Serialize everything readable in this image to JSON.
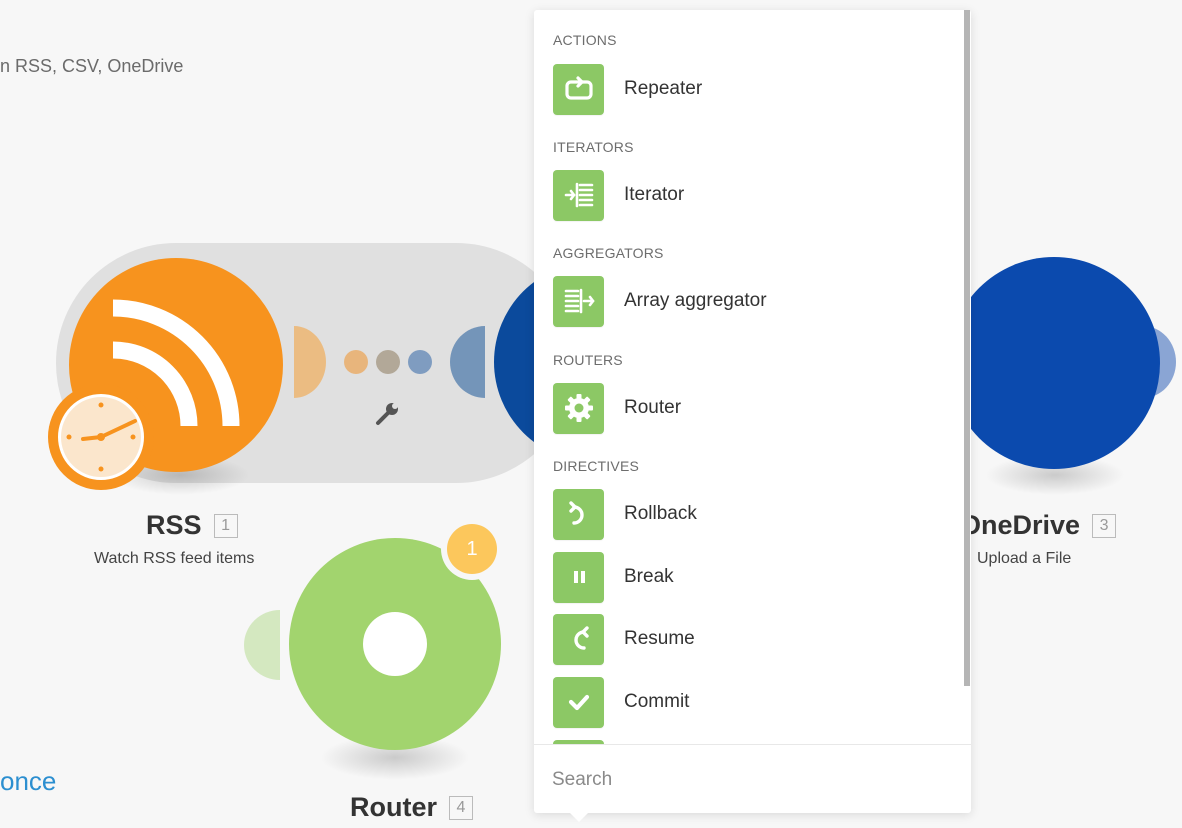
{
  "scenario": {
    "subtitle": "n RSS, CSV, OneDrive",
    "run_once": "once"
  },
  "modules": {
    "rss": {
      "title": "RSS",
      "number": "1",
      "subtitle": "Watch RSS feed items",
      "color": "#f7931e"
    },
    "onedrive": {
      "title": "OneDrive",
      "number": "3",
      "subtitle": "Upload a File",
      "color": "#0b4aae"
    },
    "router": {
      "title": "Router",
      "number": "4",
      "badge": "1",
      "color": "#a2d46e"
    }
  },
  "link": {
    "dots": [
      "#e8b57c",
      "#b2a898",
      "#7f9cc0"
    ],
    "settings_icon": "wrench-icon"
  },
  "menu": {
    "accent": "#8cc865",
    "sections": [
      {
        "label": "ACTIONS",
        "items": [
          {
            "label": "Repeater",
            "icon": "repeat-icon"
          }
        ]
      },
      {
        "label": "ITERATORS",
        "items": [
          {
            "label": "Iterator",
            "icon": "iterator-icon"
          }
        ]
      },
      {
        "label": "AGGREGATORS",
        "items": [
          {
            "label": "Array aggregator",
            "icon": "aggregator-icon"
          }
        ]
      },
      {
        "label": "ROUTERS",
        "items": [
          {
            "label": "Router",
            "icon": "gear-icon"
          }
        ]
      },
      {
        "label": "DIRECTIVES",
        "items": [
          {
            "label": "Rollback",
            "icon": "rollback-icon"
          },
          {
            "label": "Break",
            "icon": "pause-icon"
          },
          {
            "label": "Resume",
            "icon": "resume-icon"
          },
          {
            "label": "Commit",
            "icon": "check-icon"
          }
        ]
      }
    ],
    "search_placeholder": "Search"
  }
}
